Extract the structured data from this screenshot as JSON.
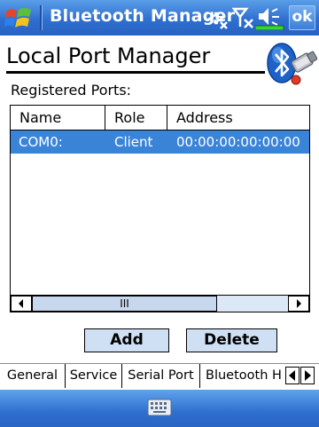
{
  "titlebar": {
    "app_title": "Bluetooth Manager",
    "ok_label": "ok",
    "icons": [
      "start-icon",
      "connectivity-icon",
      "signal-off-icon",
      "volume-icon",
      "battery-icon"
    ]
  },
  "header": {
    "title": "Local Port Manager",
    "icon": "bluetooth-emblem-icon"
  },
  "ports": {
    "label": "Registered Ports:",
    "columns": [
      "Name",
      "Role",
      "Address"
    ],
    "rows": [
      {
        "name": "COM0:",
        "role": "Client",
        "address": "00:00:00:00:00:00"
      }
    ],
    "selected_row": 0,
    "scrollbar_grip": "III"
  },
  "buttons": {
    "add": "Add",
    "delete": "Delete"
  },
  "tabs": {
    "items": [
      "General",
      "Service",
      "Serial Port",
      "Bluetooth H"
    ],
    "active": "Serial Port"
  },
  "menubar": {
    "icon": "keyboard-icon"
  },
  "colors": {
    "titlebar": "#2f6fd0",
    "selection": "#3a84d8",
    "button": "#cfe0f4"
  }
}
